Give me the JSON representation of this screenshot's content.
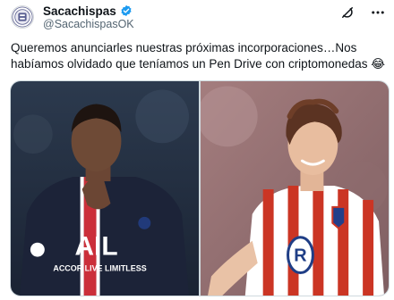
{
  "account": {
    "display_name": "Sacachispas",
    "handle": "@SacachispasOK",
    "verified": true,
    "avatar_icon": "club-crest-icon"
  },
  "actions": {
    "grok_icon": "grok-icon",
    "more_icon": "more-options-icon"
  },
  "tweet": {
    "text": "Queremos anunciarles nuestras próximas incorporaciones…Nos\nhabíamos olvidado que teníamos un Pen Drive con criptomonedas 😂"
  },
  "media": {
    "photo_count": 2,
    "left_photo": {
      "kit_text": "AIL",
      "sponsor_text": "ACCOR LIVE LIMITLESS"
    },
    "right_photo": {
      "kit_letter": "R"
    }
  },
  "colors": {
    "accent": "#1d9bf0",
    "text": "#0f1419",
    "muted": "#536471",
    "psg_navy": "#1c2338",
    "atletico_red": "#cb3524"
  }
}
